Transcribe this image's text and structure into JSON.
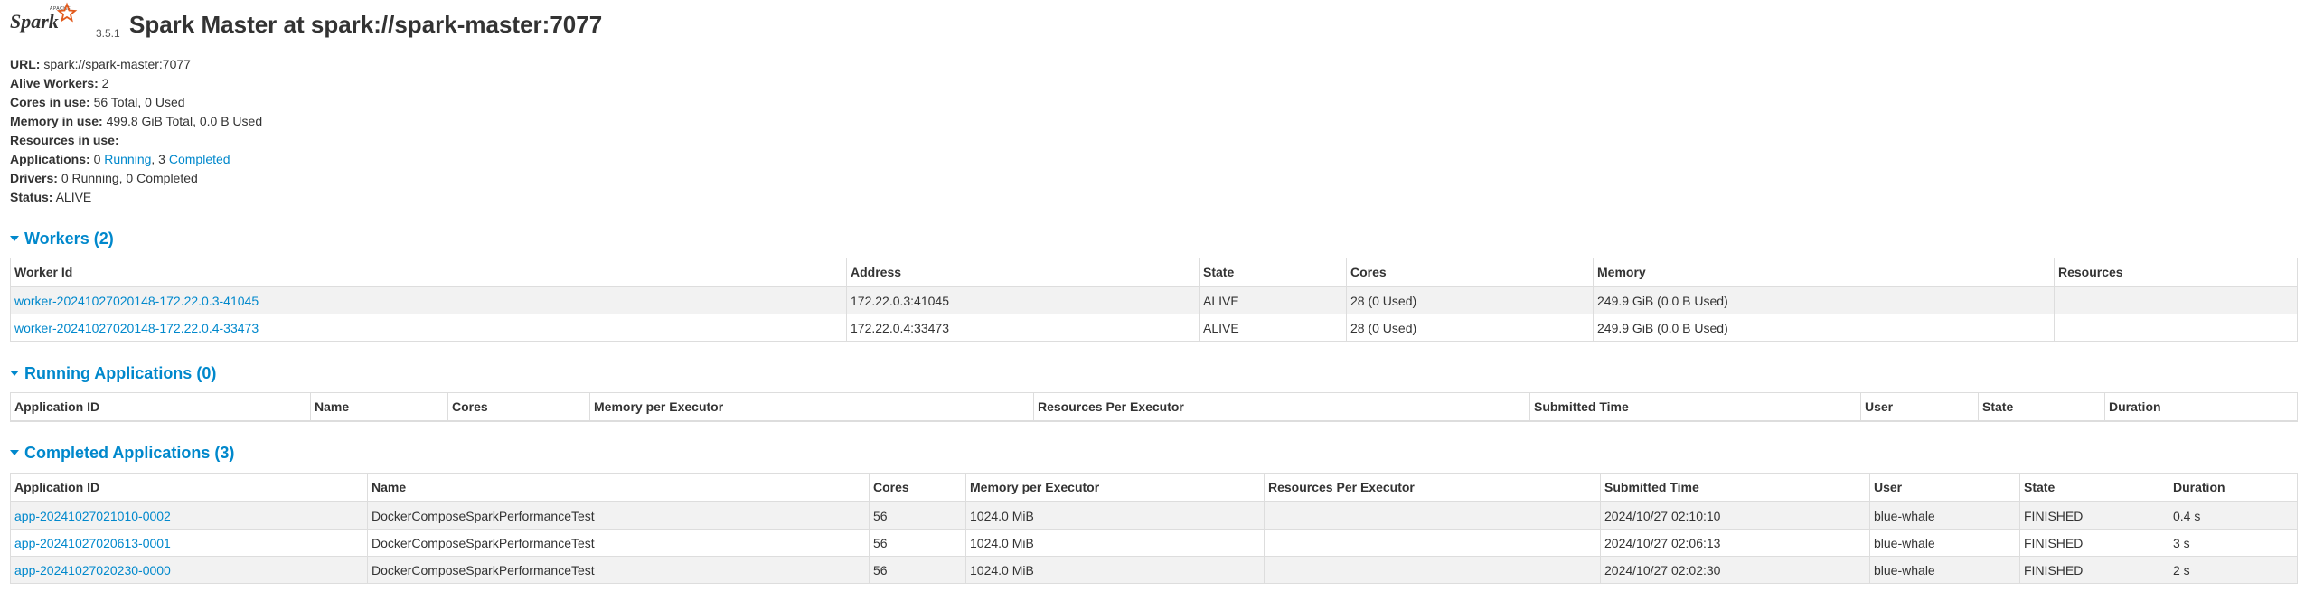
{
  "header": {
    "logo_text": "Spark",
    "logo_small_text": "APACHE",
    "version": "3.5.1",
    "title": "Spark Master at spark://spark-master:7077"
  },
  "summary": [
    {
      "label": "URL:",
      "value": "spark://spark-master:7077"
    },
    {
      "label": "Alive Workers:",
      "value": "2"
    },
    {
      "label": "Cores in use:",
      "value": "56 Total, 0 Used"
    },
    {
      "label": "Memory in use:",
      "value": "499.8 GiB Total, 0.0 B Used"
    },
    {
      "label": "Resources in use:",
      "value": ""
    },
    {
      "label": "Applications:",
      "prefix": "0",
      "running_link": "Running",
      "separator": ", 3",
      "completed_link": "Completed"
    },
    {
      "label": "Drivers:",
      "value": "0 Running, 0 Completed"
    },
    {
      "label": "Status:",
      "value": "ALIVE"
    }
  ],
  "workers": {
    "title": "Workers (2)",
    "columns": [
      "Worker Id",
      "Address",
      "State",
      "Cores",
      "Memory",
      "Resources"
    ],
    "rows": [
      [
        "worker-20241027020148-172.22.0.3-41045",
        "172.22.0.3:41045",
        "ALIVE",
        "28 (0 Used)",
        "249.9 GiB (0.0 B Used)",
        ""
      ],
      [
        "worker-20241027020148-172.22.0.4-33473",
        "172.22.0.4:33473",
        "ALIVE",
        "28 (0 Used)",
        "249.9 GiB (0.0 B Used)",
        ""
      ]
    ]
  },
  "running_apps": {
    "title": "Running Applications (0)",
    "columns": [
      "Application ID",
      "Name",
      "Cores",
      "Memory per Executor",
      "Resources Per Executor",
      "Submitted Time",
      "User",
      "State",
      "Duration"
    ],
    "rows": []
  },
  "completed_apps": {
    "title": "Completed Applications (3)",
    "columns": [
      "Application ID",
      "Name",
      "Cores",
      "Memory per Executor",
      "Resources Per Executor",
      "Submitted Time",
      "User",
      "State",
      "Duration"
    ],
    "rows": [
      [
        "app-20241027021010-0002",
        "DockerComposeSparkPerformanceTest",
        "56",
        "1024.0 MiB",
        "",
        "2024/10/27 02:10:10",
        "blue-whale",
        "FINISHED",
        "0.4 s"
      ],
      [
        "app-20241027020613-0001",
        "DockerComposeSparkPerformanceTest",
        "56",
        "1024.0 MiB",
        "",
        "2024/10/27 02:06:13",
        "blue-whale",
        "FINISHED",
        "3 s"
      ],
      [
        "app-20241027020230-0000",
        "DockerComposeSparkPerformanceTest",
        "56",
        "1024.0 MiB",
        "",
        "2024/10/27 02:02:30",
        "blue-whale",
        "FINISHED",
        "2 s"
      ]
    ]
  },
  "colors": {
    "link": "#0088cc",
    "logo_star": "#e25a1c",
    "row_stripe": "#f2f2f2"
  }
}
